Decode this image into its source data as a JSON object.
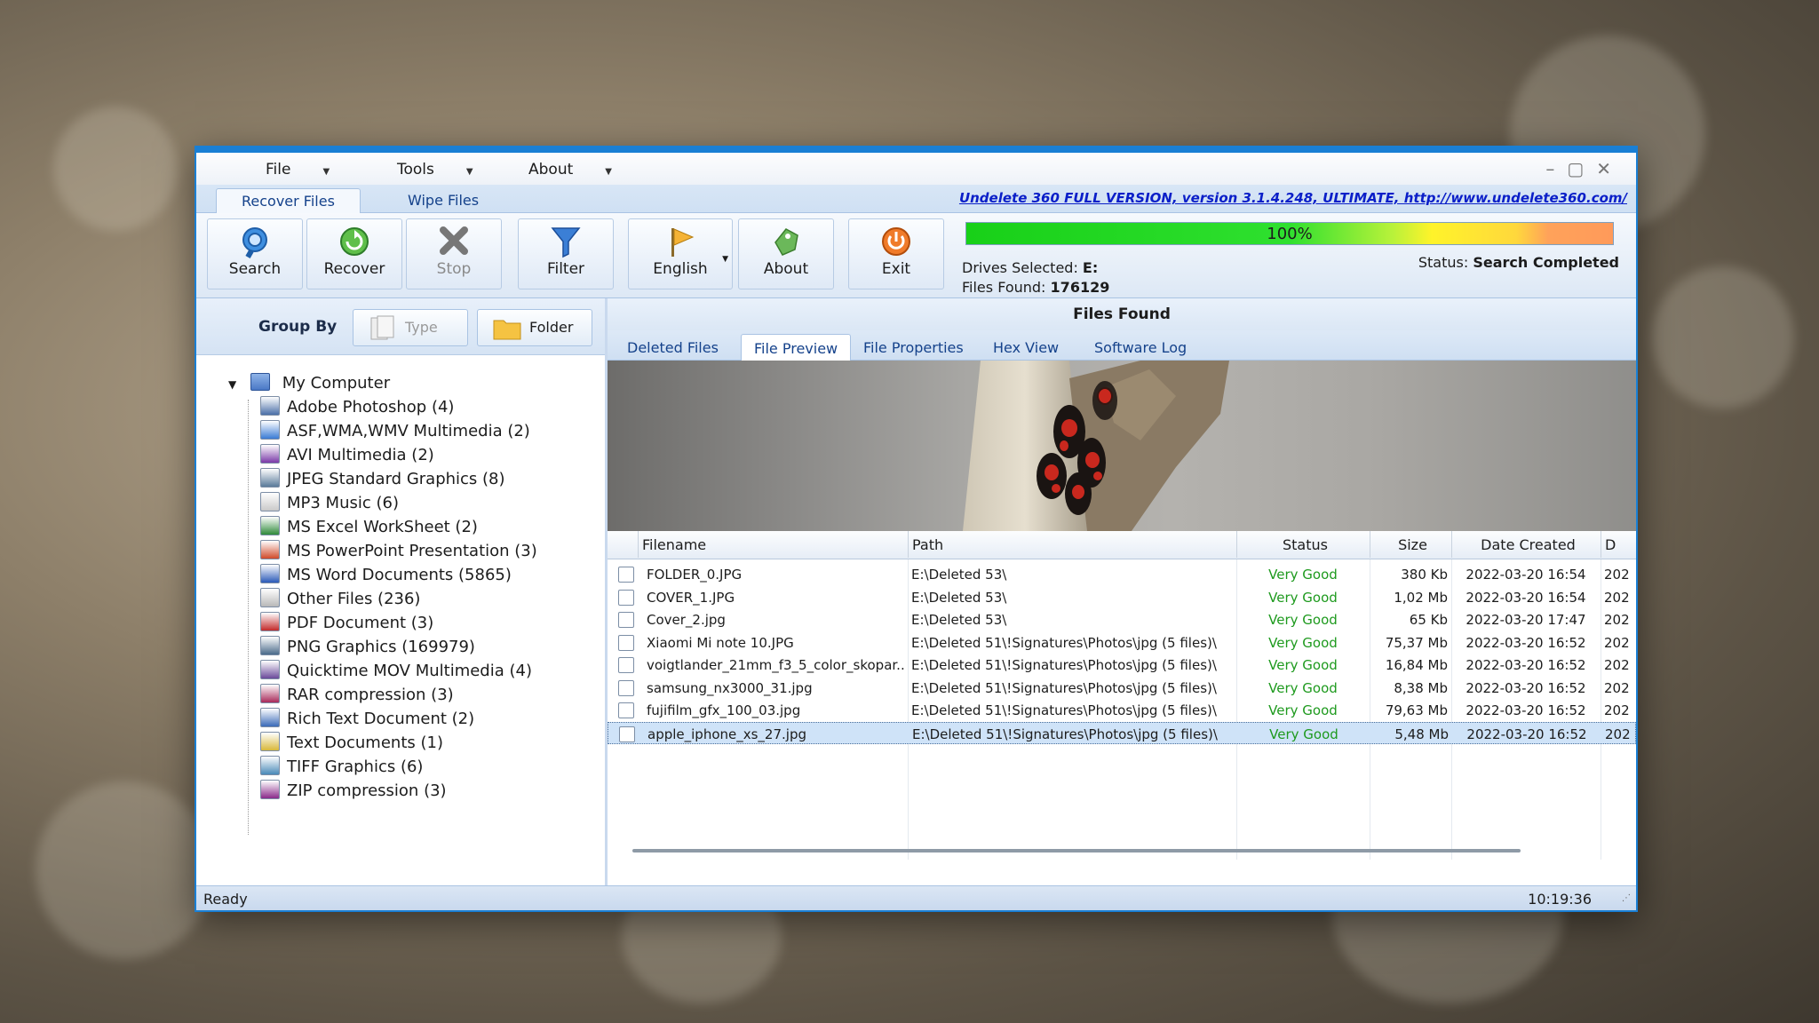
{
  "menu": {
    "file": "File",
    "tools": "Tools",
    "about": "About"
  },
  "ribbon_tabs": {
    "recover": "Recover Files",
    "wipe": "Wipe Files"
  },
  "version_link": "Undelete 360 FULL VERSION, version 3.1.4.248, ULTIMATE, http://www.undelete360.com/",
  "toolbar": {
    "search": "Search",
    "recover": "Recover",
    "stop": "Stop",
    "filter": "Filter",
    "english": "English",
    "about": "About",
    "exit": "Exit"
  },
  "status_panel": {
    "progress_text": "100%",
    "progress": 1.0,
    "drives_label": "Drives Selected:",
    "drives_value": "E:",
    "files_label": "Files Found:",
    "files_value": "176129",
    "status_label": "Status:",
    "status_value": "Search Completed"
  },
  "group_by": {
    "label": "Group By",
    "type": "Type",
    "folder": "Folder"
  },
  "tree": {
    "root": "My Computer",
    "items": [
      "Adobe Photoshop (4)",
      "ASF,WMA,WMV Multimedia (2)",
      "AVI Multimedia (2)",
      "JPEG Standard Graphics (8)",
      "MP3 Music (6)",
      "MS Excel WorkSheet (2)",
      "MS PowerPoint Presentation (3)",
      "MS Word Documents (5865)",
      "Other Files (236)",
      "PDF Document (3)",
      "PNG Graphics (169979)",
      "Quicktime MOV Multimedia (4)",
      "RAR compression (3)",
      "Rich Text Document (2)",
      "Text Documents (1)",
      "TIFF Graphics (6)",
      "ZIP compression (3)"
    ]
  },
  "files_found_title": "Files Found",
  "content_tabs": [
    "Deleted Files",
    "File Preview",
    "File Properties",
    "Hex View",
    "Software Log"
  ],
  "table": {
    "columns": [
      "Filename",
      "Path",
      "Status",
      "Size",
      "Date Created",
      "D"
    ],
    "rows": [
      [
        "FOLDER_0.JPG",
        "E:\\Deleted 53\\",
        "Very Good",
        "380 Kb",
        "2022-03-20 16:54",
        "202"
      ],
      [
        "COVER_1.JPG",
        "E:\\Deleted 53\\",
        "Very Good",
        "1,02 Mb",
        "2022-03-20 16:54",
        "202"
      ],
      [
        "Cover_2.jpg",
        "E:\\Deleted 53\\",
        "Very Good",
        "65 Kb",
        "2022-03-20 17:47",
        "202"
      ],
      [
        "Xiaomi Mi note 10.JPG",
        "E:\\Deleted 51\\!Signatures\\Photos\\jpg (5 files)\\",
        "Very Good",
        "75,37 Mb",
        "2022-03-20 16:52",
        "202"
      ],
      [
        "voigtlander_21mm_f3_5_color_skopar...",
        "E:\\Deleted 51\\!Signatures\\Photos\\jpg (5 files)\\",
        "Very Good",
        "16,84 Mb",
        "2022-03-20 16:52",
        "202"
      ],
      [
        "samsung_nx3000_31.jpg",
        "E:\\Deleted 51\\!Signatures\\Photos\\jpg (5 files)\\",
        "Very Good",
        "8,38 Mb",
        "2022-03-20 16:52",
        "202"
      ],
      [
        "fujifilm_gfx_100_03.jpg",
        "E:\\Deleted 51\\!Signatures\\Photos\\jpg (5 files)\\",
        "Very Good",
        "79,63 Mb",
        "2022-03-20 16:52",
        "202"
      ],
      [
        "apple_iphone_xs_27.jpg",
        "E:\\Deleted 51\\!Signatures\\Photos\\jpg (5 files)\\",
        "Very Good",
        "5,48 Mb",
        "2022-03-20 16:52",
        "202"
      ]
    ],
    "selected_index": 7
  },
  "statusbar": {
    "left": "Ready",
    "time": "10:19:36"
  },
  "colors": {
    "accent": "#1a7fd4",
    "good": "#1e9a1e",
    "link": "#0a1ec8"
  }
}
